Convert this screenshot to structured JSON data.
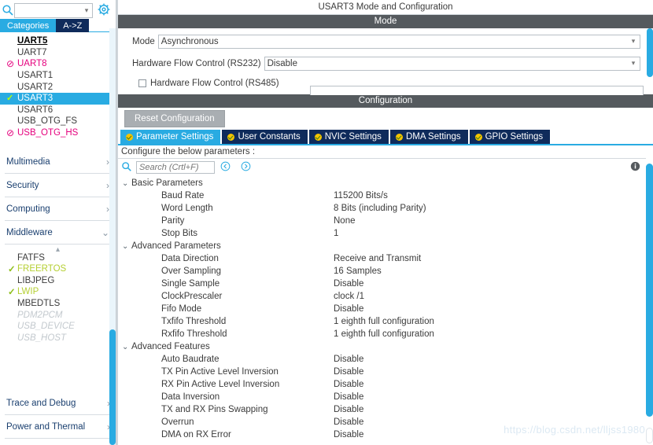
{
  "sidebar": {
    "search": {
      "value": "",
      "placeholder": ""
    },
    "gear_icon": "gear-icon",
    "tabs": [
      {
        "label": "Categories",
        "active": true
      },
      {
        "label": "A->Z",
        "active": false
      }
    ],
    "peripherals": [
      {
        "label": "UART5",
        "state": "header"
      },
      {
        "label": "UART7",
        "state": "none"
      },
      {
        "label": "UART8",
        "state": "unavailable",
        "mark": "⊘"
      },
      {
        "label": "USART1",
        "state": "none"
      },
      {
        "label": "USART2",
        "state": "none"
      },
      {
        "label": "USART3",
        "state": "selected",
        "mark": "✓"
      },
      {
        "label": "USART6",
        "state": "none"
      },
      {
        "label": "USB_OTG_FS",
        "state": "none"
      },
      {
        "label": "USB_OTG_HS",
        "state": "unavailable",
        "mark": "⊘"
      }
    ],
    "groups": [
      {
        "label": "Multimedia",
        "expanded": false
      },
      {
        "label": "Security",
        "expanded": false
      },
      {
        "label": "Computing",
        "expanded": false
      },
      {
        "label": "Middleware",
        "expanded": true
      }
    ],
    "middleware": [
      {
        "label": "FATFS",
        "state": "none"
      },
      {
        "label": "FREERTOS",
        "state": "enabled",
        "mark": "✓"
      },
      {
        "label": "LIBJPEG",
        "state": "none"
      },
      {
        "label": "LWIP",
        "state": "enabled",
        "mark": "✓"
      },
      {
        "label": "MBEDTLS",
        "state": "none"
      },
      {
        "label": "PDM2PCM",
        "state": "disabled"
      },
      {
        "label": "USB_DEVICE",
        "state": "disabled"
      },
      {
        "label": "USB_HOST",
        "state": "disabled"
      }
    ],
    "bottom_groups": [
      {
        "label": "Trace and Debug",
        "expanded": false
      },
      {
        "label": "Power and Thermal",
        "expanded": false
      }
    ]
  },
  "header": {
    "title": "USART3 Mode and Configuration"
  },
  "mode": {
    "section_label": "Mode",
    "mode_label": "Mode",
    "mode_value": "Asynchronous",
    "hwfc232_label": "Hardware Flow Control (RS232)",
    "hwfc232_value": "Disable",
    "hwfc485_label": "Hardware Flow Control (RS485)",
    "hwfc485_checked": false
  },
  "configuration": {
    "section_label": "Configuration",
    "reset_label": "Reset Configuration",
    "tabs": [
      {
        "label": "Parameter Settings",
        "active": true
      },
      {
        "label": "User Constants",
        "active": false
      },
      {
        "label": "NVIC Settings",
        "active": false
      },
      {
        "label": "DMA Settings",
        "active": false
      },
      {
        "label": "GPIO Settings",
        "active": false
      }
    ],
    "note": "Configure the below parameters :",
    "search": {
      "value": "",
      "placeholder": "Search (Crtl+F)"
    },
    "nav_prev_icon": "chevron-left-circle-icon",
    "nav_next_icon": "chevron-right-circle-icon",
    "info_icon": "info-icon"
  },
  "parameters": [
    {
      "group": "Basic Parameters",
      "expanded": true,
      "rows": [
        {
          "name": "Baud Rate",
          "value": "115200 Bits/s"
        },
        {
          "name": "Word Length",
          "value": "8 Bits (including Parity)"
        },
        {
          "name": "Parity",
          "value": "None"
        },
        {
          "name": "Stop Bits",
          "value": "1"
        }
      ]
    },
    {
      "group": "Advanced Parameters",
      "expanded": true,
      "rows": [
        {
          "name": "Data Direction",
          "value": "Receive and Transmit"
        },
        {
          "name": "Over Sampling",
          "value": "16 Samples"
        },
        {
          "name": "Single Sample",
          "value": "Disable"
        },
        {
          "name": "ClockPrescaler",
          "value": "clock /1"
        },
        {
          "name": "Fifo Mode",
          "value": "Disable"
        },
        {
          "name": "Txfifo Threshold",
          "value": "1 eighth full configuration"
        },
        {
          "name": "Rxfifo Threshold",
          "value": "1 eighth full configuration"
        }
      ]
    },
    {
      "group": "Advanced Features",
      "expanded": true,
      "rows": [
        {
          "name": "Auto Baudrate",
          "value": "Disable"
        },
        {
          "name": "TX Pin Active Level Inversion",
          "value": "Disable"
        },
        {
          "name": "RX Pin Active Level Inversion",
          "value": "Disable"
        },
        {
          "name": "Data Inversion",
          "value": "Disable"
        },
        {
          "name": "TX and RX Pins Swapping",
          "value": "Disable"
        },
        {
          "name": "Overrun",
          "value": "Disable"
        },
        {
          "name": "DMA on RX Error",
          "value": "Disable"
        }
      ]
    }
  ],
  "watermark": {
    "text": "https://blog.csdn.net/lljss1980"
  },
  "colors": {
    "accent": "#29abe2",
    "tab_dark": "#0f2b5b",
    "section_bar": "#555a5e",
    "unavailable": "#e5007d",
    "enabled": "#b5cf32",
    "disabled": "#c3c9ce"
  }
}
